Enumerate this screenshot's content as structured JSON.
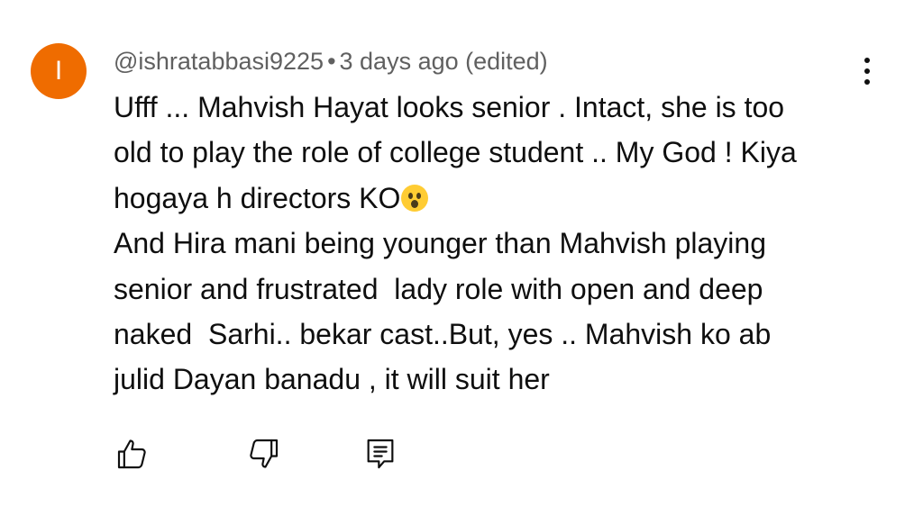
{
  "comment": {
    "avatar_letter": "I",
    "avatar_color": "#ef6c00",
    "author": "@ishratabbasi9225",
    "separator": "•",
    "time": "3 days ago (edited)",
    "lines": [
      "Ufff ... Mahvish Hayat looks senior . Intact, she is too",
      "old to play the role of college student .. My God ! Kiya",
      "hogaya h directors KO",
      "And Hira mani being younger than Mahvish playing",
      "senior and frustrated  lady role with open and deep",
      "naked  Sarhi.. bekar cast..But, yes .. Mahvish ko ab",
      "julid Dayan banadu , it will suit her"
    ],
    "emoji": "astonished-face-emoji"
  },
  "actions": {
    "like_icon": "thumbs-up-icon",
    "dislike_icon": "thumbs-down-icon",
    "reply_icon": "reply-comment-icon",
    "menu_icon": "more-vertical-icon"
  },
  "colors": {
    "text": "#0f0f0f",
    "meta_text": "#606060",
    "background": "#ffffff"
  }
}
